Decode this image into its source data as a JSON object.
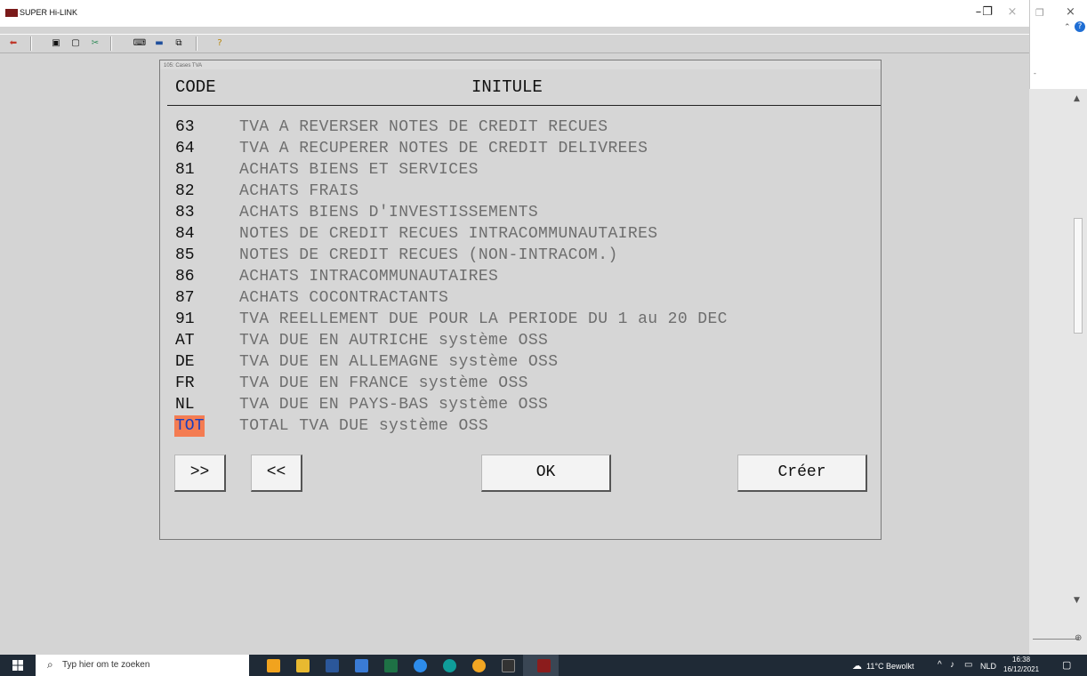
{
  "window": {
    "title": "SUPER Hi-LINK",
    "minimize": "–",
    "restore": "❐",
    "close": "×"
  },
  "dialog": {
    "title": "105: Cases TVA",
    "col_code": "CODE",
    "col_intitule": "INITULE",
    "rows": [
      {
        "code": "63",
        "label": "TVA A REVERSER NOTES DE CREDIT RECUES"
      },
      {
        "code": "64",
        "label": "TVA A RECUPERER NOTES DE CREDIT DELIVREES"
      },
      {
        "code": "81",
        "label": "ACHATS BIENS ET SERVICES"
      },
      {
        "code": "82",
        "label": "ACHATS FRAIS"
      },
      {
        "code": "83",
        "label": "ACHATS BIENS D'INVESTISSEMENTS"
      },
      {
        "code": "84",
        "label": "NOTES DE CREDIT RECUES INTRACOMMUNAUTAIRES"
      },
      {
        "code": "85",
        "label": "NOTES DE CREDIT RECUES (NON-INTRACOM.)"
      },
      {
        "code": "86",
        "label": "ACHATS INTRACOMMUNAUTAIRES"
      },
      {
        "code": "87",
        "label": "ACHATS COCONTRACTANTS"
      },
      {
        "code": "91",
        "label": "TVA REELLEMENT DUE POUR LA PERIODE DU 1 au 20 DEC"
      },
      {
        "code": "AT",
        "label": "TVA DUE EN AUTRICHE système OSS"
      },
      {
        "code": "DE",
        "label": "TVA DUE EN ALLEMAGNE système OSS"
      },
      {
        "code": "FR",
        "label": "TVA DUE EN FRANCE système OSS"
      },
      {
        "code": "NL",
        "label": "TVA DUE EN PAYS-BAS système OSS"
      },
      {
        "code": "TOT",
        "label": "TOTAL TVA DUE système OSS",
        "selected": true
      }
    ],
    "buttons": {
      "next": ">>",
      "prev": "<<",
      "ok": "OK",
      "create": "Créer"
    }
  },
  "taskbar": {
    "search_placeholder": "Typ hier om te zoeken",
    "weather": "11°C  Bewolkt",
    "language": "NLD",
    "time": "16:38",
    "date": "16/12/2021"
  },
  "colors": {
    "selected_bg": "#f47c52",
    "selected_fg": "#1a3fbf",
    "label_gray": "#6e6e6e"
  }
}
